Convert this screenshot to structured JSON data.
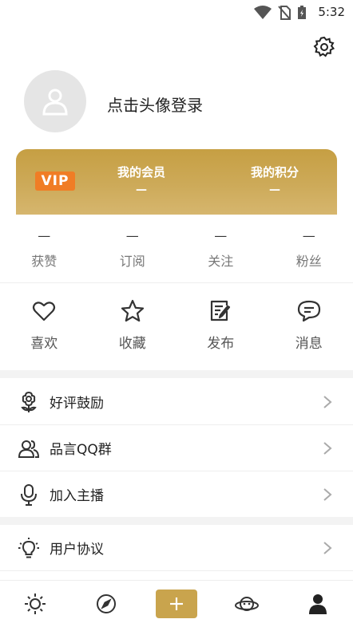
{
  "status_bar": {
    "time": "5:32"
  },
  "profile": {
    "login_prompt": "点击头像登录"
  },
  "vip_card": {
    "badge": "VIP",
    "membership_label": "我的会员",
    "membership_value": "—",
    "points_label": "我的积分",
    "points_value": "—"
  },
  "stats": [
    {
      "value": "—",
      "label": "获赞"
    },
    {
      "value": "—",
      "label": "订阅"
    },
    {
      "value": "—",
      "label": "关注"
    },
    {
      "value": "—",
      "label": "粉丝"
    }
  ],
  "actions": [
    {
      "label": "喜欢",
      "icon": "heart-icon"
    },
    {
      "label": "收藏",
      "icon": "star-icon"
    },
    {
      "label": "发布",
      "icon": "edit-note-icon"
    },
    {
      "label": "消息",
      "icon": "chat-bubble-icon"
    }
  ],
  "menu": [
    {
      "label": "好评鼓励",
      "icon": "flower-icon"
    },
    {
      "label": "品言QQ群",
      "icon": "group-icon"
    },
    {
      "label": "加入主播",
      "icon": "microphone-icon"
    },
    {
      "label": "用户协议",
      "icon": "lightbulb-icon"
    }
  ],
  "bottom_nav": [
    {
      "icon": "sun-icon"
    },
    {
      "icon": "compass-icon"
    },
    {
      "icon": "plus-icon"
    },
    {
      "icon": "planet-icon"
    },
    {
      "icon": "user-icon"
    }
  ],
  "colors": {
    "accent_gold": "#c9a44d",
    "vip_badge": "#f07d25"
  }
}
